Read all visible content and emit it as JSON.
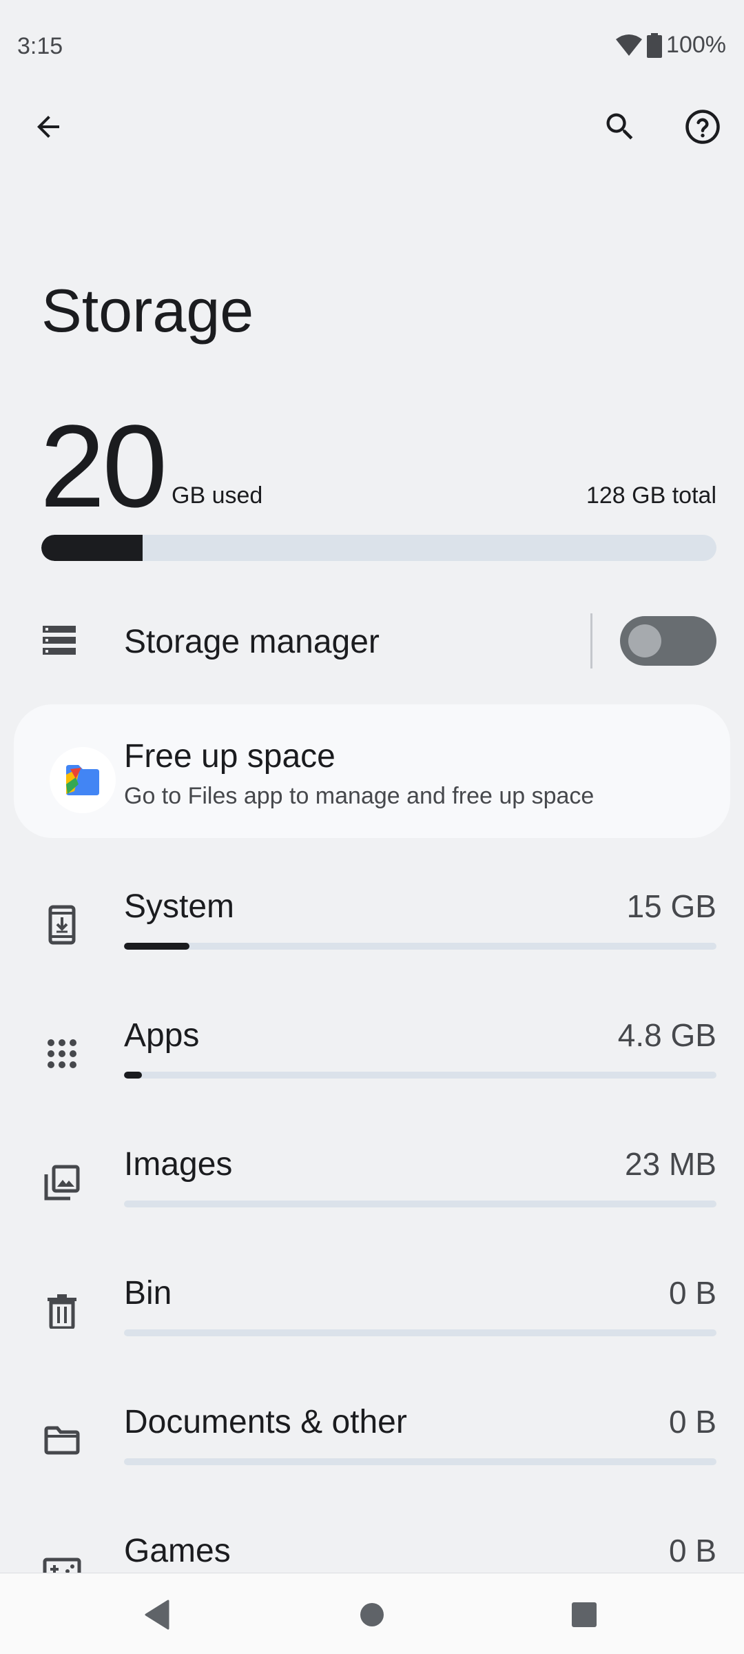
{
  "status_bar": {
    "time": "3:15",
    "battery": "100%"
  },
  "app_bar": {
    "back_icon": "arrow-back-icon",
    "search_icon": "search-icon",
    "help_icon": "help-icon"
  },
  "page": {
    "title": "Storage"
  },
  "usage": {
    "used_number": "20",
    "used_unit": "GB used",
    "total": "128 GB total",
    "used_fraction": 0.15
  },
  "storage_manager": {
    "label": "Storage manager",
    "enabled": false
  },
  "free_up_space": {
    "title": "Free up space",
    "subtitle": "Go to Files app to manage and free up space"
  },
  "categories": [
    {
      "label": "System",
      "value": "15 GB",
      "fraction": 0.11,
      "icon": "system-update-icon"
    },
    {
      "label": "Apps",
      "value": "4.8 GB",
      "fraction": 0.03,
      "icon": "apps-grid-icon"
    },
    {
      "label": "Images",
      "value": "23 MB",
      "fraction": 0.0,
      "icon": "images-icon"
    },
    {
      "label": "Bin",
      "value": "0 B",
      "fraction": 0.0,
      "icon": "trash-icon"
    },
    {
      "label": "Documents & other",
      "value": "0 B",
      "fraction": 0.0,
      "icon": "folder-icon"
    },
    {
      "label": "Games",
      "value": "0 B",
      "fraction": 0.0,
      "icon": "gamepad-icon"
    }
  ],
  "colors": {
    "background": "#f0f1f3",
    "bar_track": "#dbe2ea",
    "bar_fill": "#1b1c1f",
    "card": "#f8f9fb"
  }
}
